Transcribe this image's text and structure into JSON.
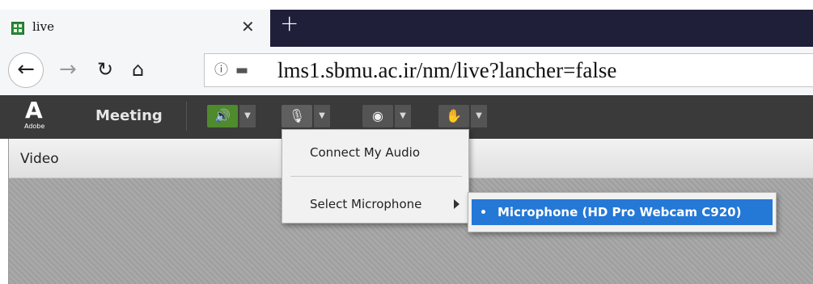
{
  "browser": {
    "tab_title": "live",
    "tab_close": "✕",
    "new_tab": "+",
    "url": "lms1.sbmu.ac.ir/nm/live?lancher=false"
  },
  "toolbar": {
    "logo_text": "Adobe",
    "meeting_label": "Meeting",
    "tools": [
      "speaker-icon",
      "microphone-icon",
      "webcam-icon",
      "raise-hand-icon"
    ],
    "speaker_active_color": "#4f8a2c"
  },
  "pod": {
    "title": "Video"
  },
  "mic_menu": {
    "connect_audio": "Connect My Audio",
    "select_microphone": "Select Microphone",
    "microphones": [
      "Microphone (HD Pro Webcam C920)"
    ],
    "selected_color": "#2478d6"
  }
}
